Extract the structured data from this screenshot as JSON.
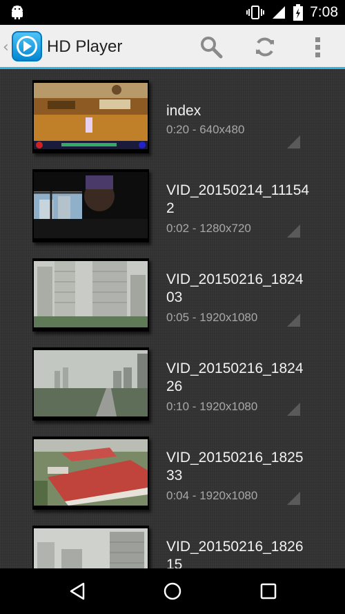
{
  "status_bar": {
    "time": "7:08"
  },
  "action_bar": {
    "title": "HD Player"
  },
  "videos": [
    {
      "title": "index",
      "meta": "0:20 - 640x480"
    },
    {
      "title": "VID_20150214_111542",
      "meta": "0:02 - 1280x720"
    },
    {
      "title": "VID_20150216_182403",
      "meta": "0:05 - 1920x1080"
    },
    {
      "title": "VID_20150216_182426",
      "meta": "0:10 - 1920x1080"
    },
    {
      "title": "VID_20150216_182533",
      "meta": "0:04 - 1920x1080"
    },
    {
      "title": "VID_20150216_182615",
      "meta": ""
    }
  ],
  "icons": {
    "status": [
      "android-icon",
      "vibrate-icon",
      "signal-icon",
      "battery-icon"
    ],
    "action_bar": [
      "search-icon",
      "refresh-icon",
      "overflow-menu-icon"
    ],
    "nav": [
      "back-icon",
      "home-icon",
      "recents-icon"
    ]
  },
  "colors": {
    "accent": "#33b5e5",
    "action_bar": "#efefef",
    "background": "#333333"
  }
}
